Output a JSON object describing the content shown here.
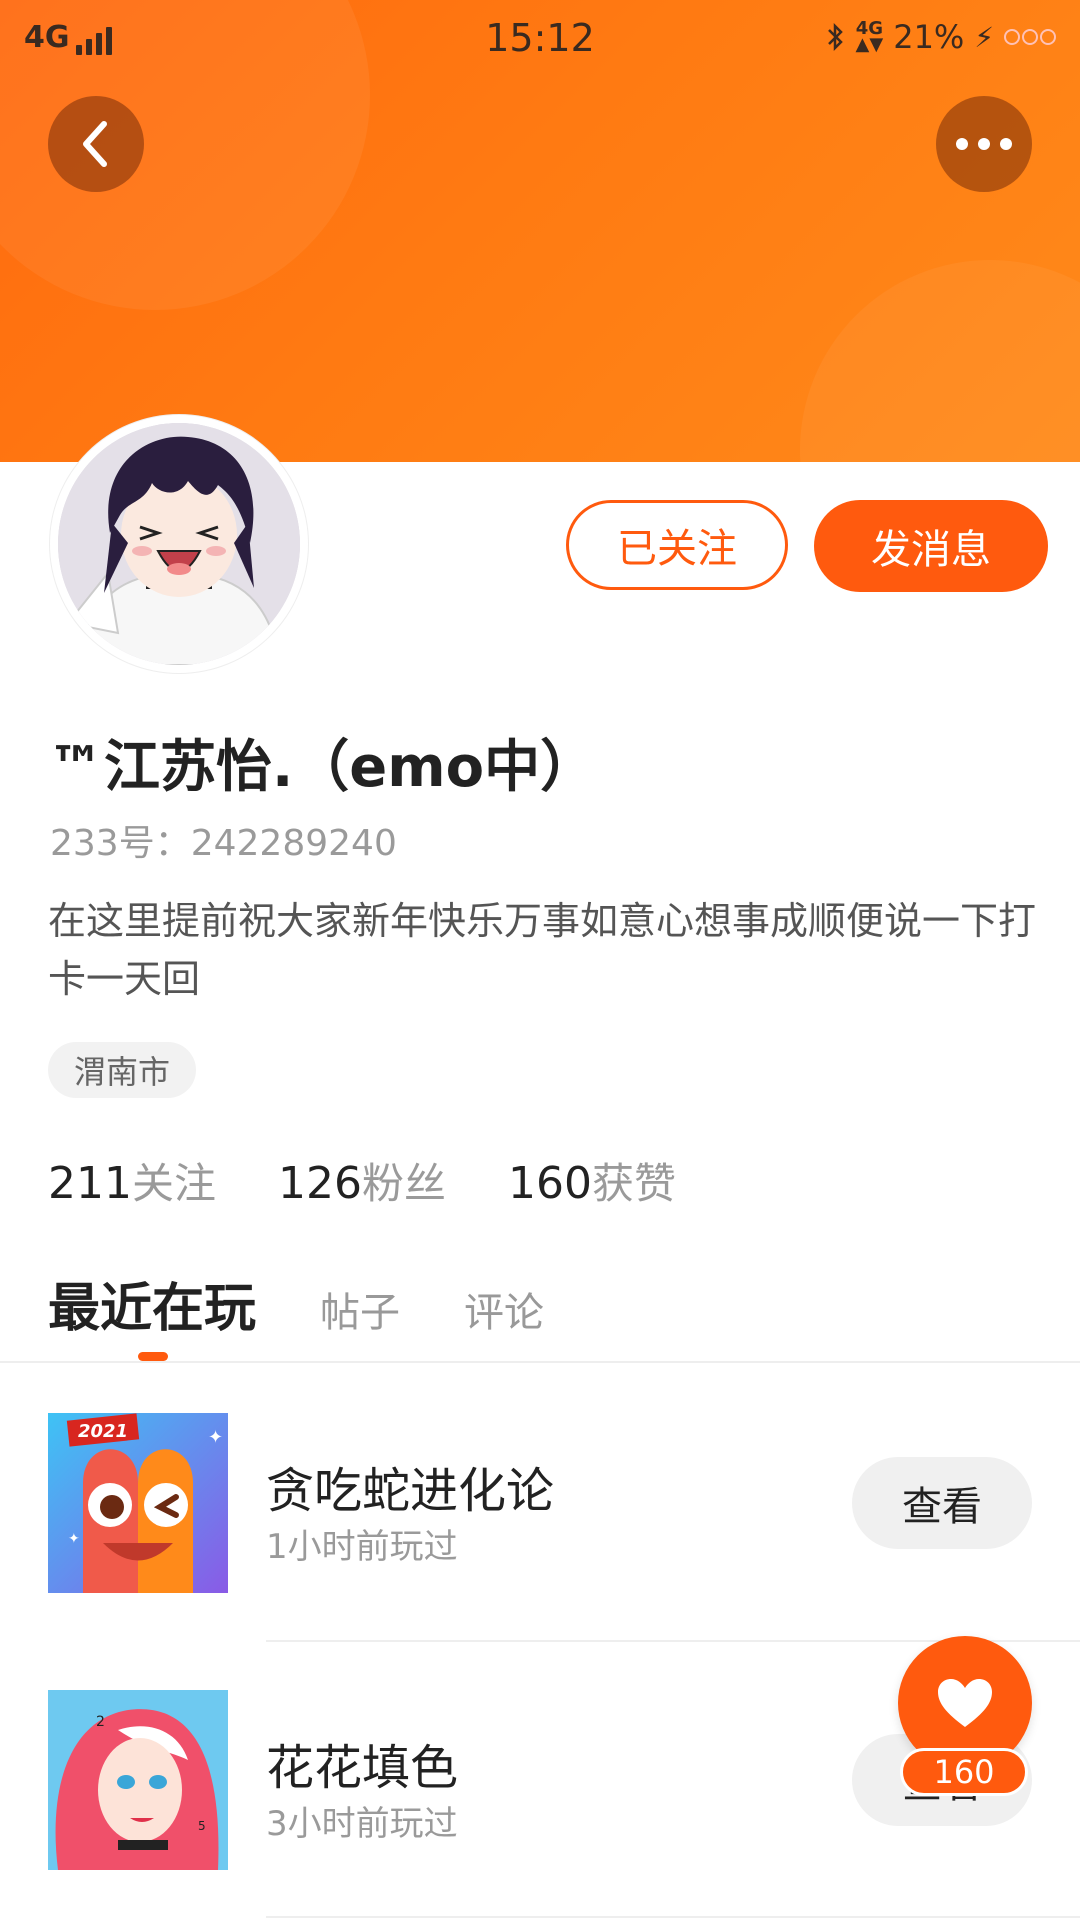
{
  "status_bar": {
    "network": "4G",
    "time": "15:12",
    "network_right": "4G",
    "battery": "21%"
  },
  "header": {
    "back_icon": "chevron-left-icon",
    "more_icon": "more-horizontal-icon",
    "colors": {
      "banner": "#ff7a12",
      "accent": "#ff5a0e"
    }
  },
  "profile": {
    "name": "™江苏怡.（emo中）",
    "id_line": "233号：242289240",
    "bio": "在这里提前祝大家新年快乐万事如意心想事成顺便说一下打卡一天回",
    "location": "渭南市",
    "follow_label": "已关注",
    "message_label": "发消息"
  },
  "stats": [
    {
      "value": "211",
      "label": "关注"
    },
    {
      "value": "126",
      "label": "粉丝"
    },
    {
      "value": "160",
      "label": "获赞"
    }
  ],
  "tabs": [
    {
      "label": "最近在玩",
      "active": true
    },
    {
      "label": "帖子",
      "active": false
    },
    {
      "label": "评论",
      "active": false
    }
  ],
  "games": [
    {
      "title": "贪吃蛇进化论",
      "played": "1小时前玩过",
      "button": "查看",
      "badge": "2021"
    },
    {
      "title": "花花填色",
      "played": "3小时前玩过",
      "button": "查看"
    }
  ],
  "like_fab": {
    "icon": "heart-icon",
    "count": "160"
  }
}
